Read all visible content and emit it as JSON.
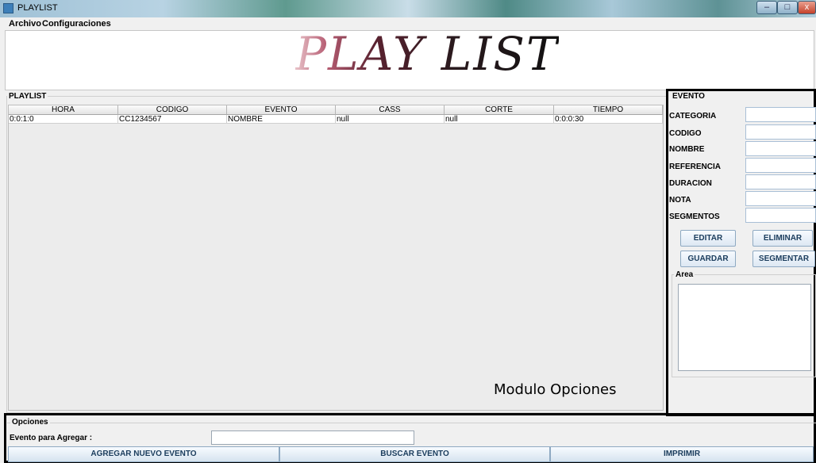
{
  "window": {
    "title": "PLAYLIST",
    "minimize": "–",
    "maximize": "□",
    "close": "x"
  },
  "menu": {
    "items": [
      "Archivo",
      "Configuraciones"
    ]
  },
  "banner": {
    "text": "PLAY LIST"
  },
  "playlist": {
    "title": "PLAYLIST",
    "columns": [
      "HORA",
      "CODIGO",
      "EVENTO",
      "CASS",
      "CORTE",
      "TIEMPO"
    ],
    "rows": [
      [
        "0:0:1:0",
        "CC1234567",
        "NOMBRE",
        "null",
        "null",
        "0:0:0:30"
      ]
    ]
  },
  "annotation": {
    "modulo_opciones": "Modulo Opciones"
  },
  "evento": {
    "title": "EVENTO",
    "fields": [
      {
        "label": "CATEGORIA",
        "value": ""
      },
      {
        "label": "CODIGO",
        "value": ""
      },
      {
        "label": "NOMBRE",
        "value": ""
      },
      {
        "label": "REFERENCIA",
        "value": ""
      },
      {
        "label": "DURACION",
        "value": ""
      },
      {
        "label": "NOTA",
        "value": ""
      },
      {
        "label": "SEGMENTOS",
        "value": ""
      }
    ],
    "buttons": {
      "editar": "EDITAR",
      "eliminar": "ELIMINAR",
      "guardar": "GUARDAR",
      "segmentar": "SEGMENTAR"
    },
    "area_title": "Area",
    "area_value": ""
  },
  "opciones": {
    "title": "Opciones",
    "evento_label": "Evento para Agregar :",
    "evento_value": "",
    "buttons": {
      "agregar": "AGREGAR NUEVO EVENTO",
      "buscar": "BUSCAR EVENTO",
      "imprimir": "IMPRIMIR"
    }
  }
}
